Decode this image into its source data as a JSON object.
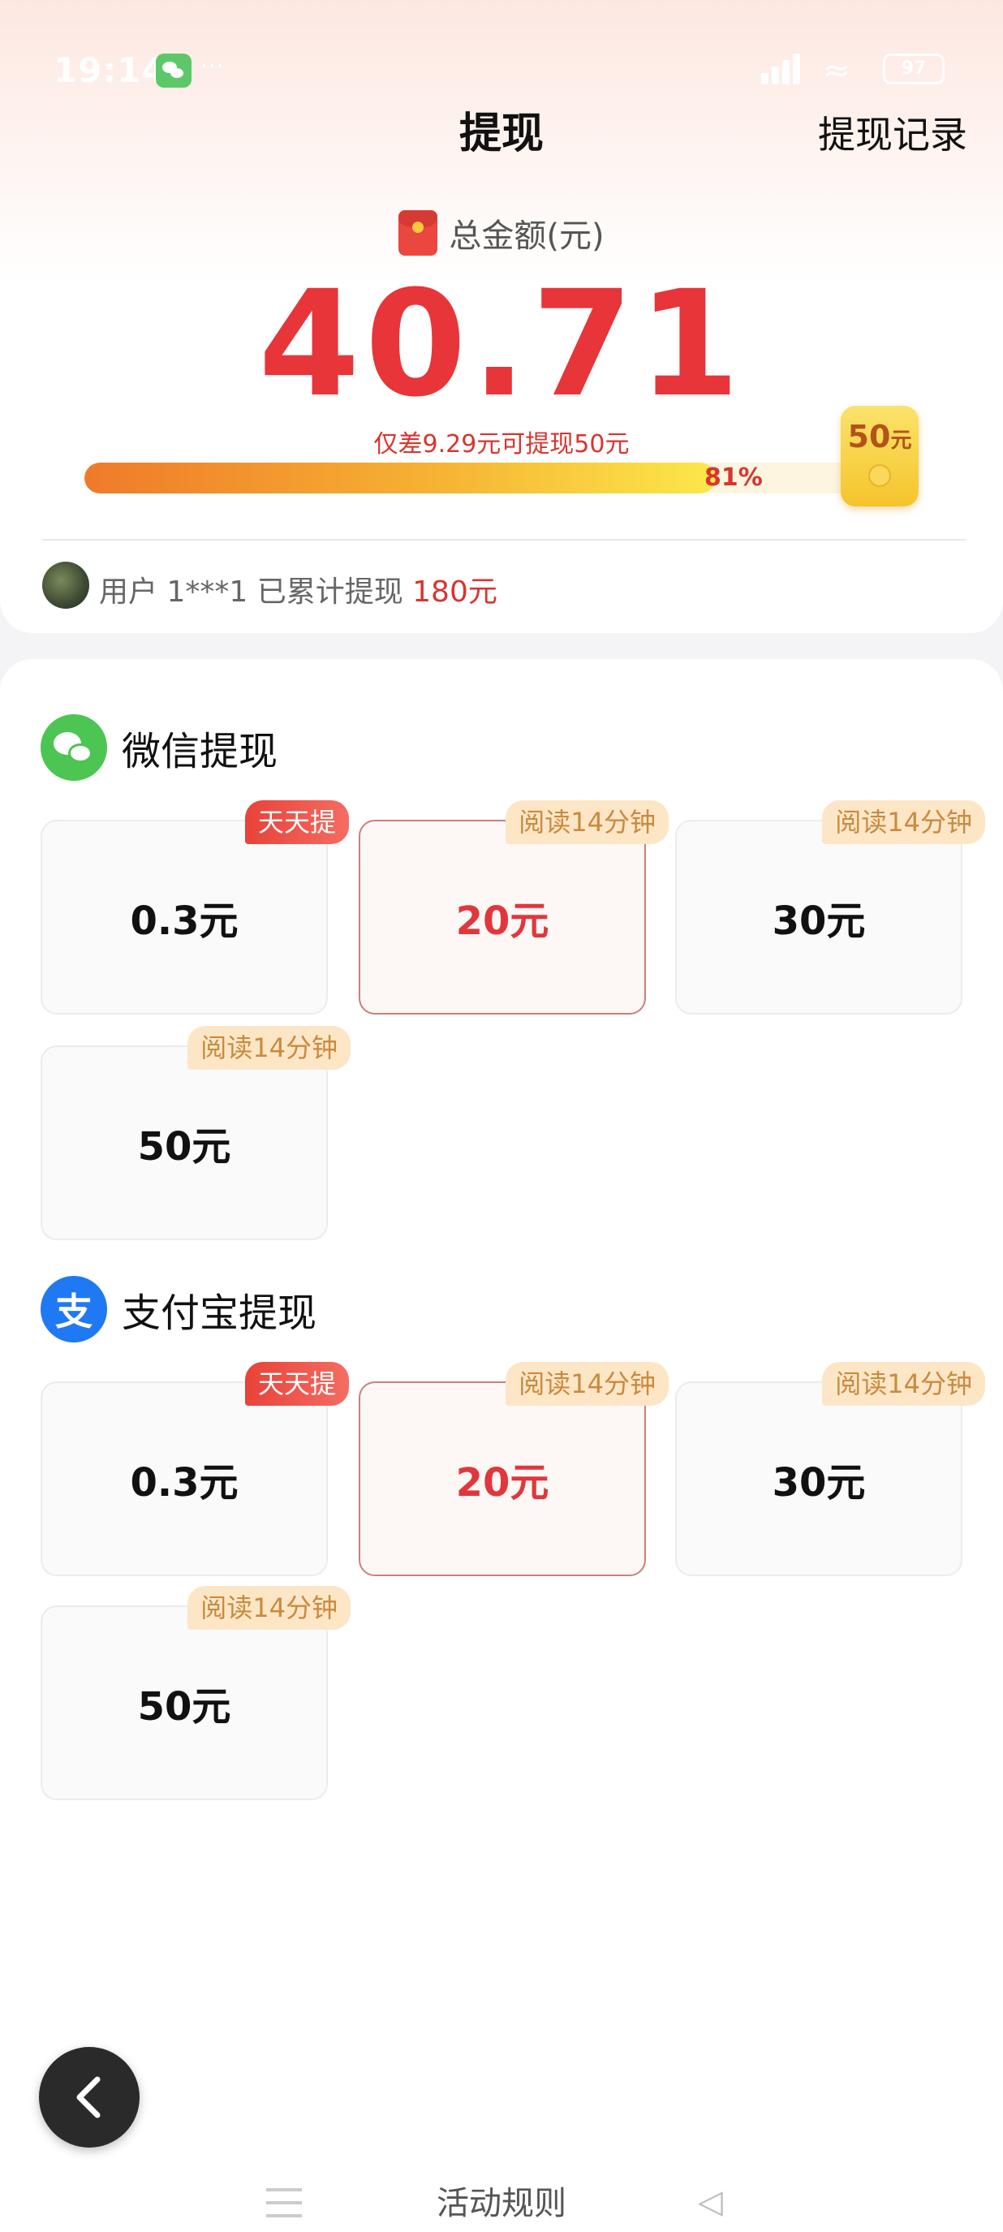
{
  "status_bar": {
    "time": "19:14",
    "dots": "···",
    "battery": "97"
  },
  "header": {
    "title": "提现",
    "history_link": "提现记录"
  },
  "balance": {
    "label": "总金额(元)",
    "amount": "40.71",
    "gap_text": "仅差9.29元可提现50元",
    "progress": 0.81,
    "progress_label": "81%",
    "target_amount": "50",
    "target_unit": "元"
  },
  "ticker": {
    "prefix": "用户 1***1 已累计提现 ",
    "amount": "180元"
  },
  "wechat": {
    "title": "微信提现",
    "options": [
      {
        "amount": "0.3元",
        "tag": "天天提"
      },
      {
        "amount": "20元",
        "tag": "阅读14分钟"
      },
      {
        "amount": "30元",
        "tag": "阅读14分钟"
      },
      {
        "amount": "50元",
        "tag": "阅读14分钟"
      }
    ]
  },
  "alipay": {
    "title": "支付宝提现",
    "icon_glyph": "支",
    "options": [
      {
        "amount": "0.3元",
        "tag": "天天提"
      },
      {
        "amount": "20元",
        "tag": "阅读14分钟"
      },
      {
        "amount": "30元",
        "tag": "阅读14分钟"
      },
      {
        "amount": "50元",
        "tag": "阅读14分钟"
      }
    ]
  },
  "footer": {
    "rules_link": "活动规则"
  },
  "colors": {
    "accent_red": "#e7353a",
    "wechat_green": "#4cc552",
    "alipay_blue": "#1f79f2",
    "tag_read_bg": "#fde6c6"
  }
}
